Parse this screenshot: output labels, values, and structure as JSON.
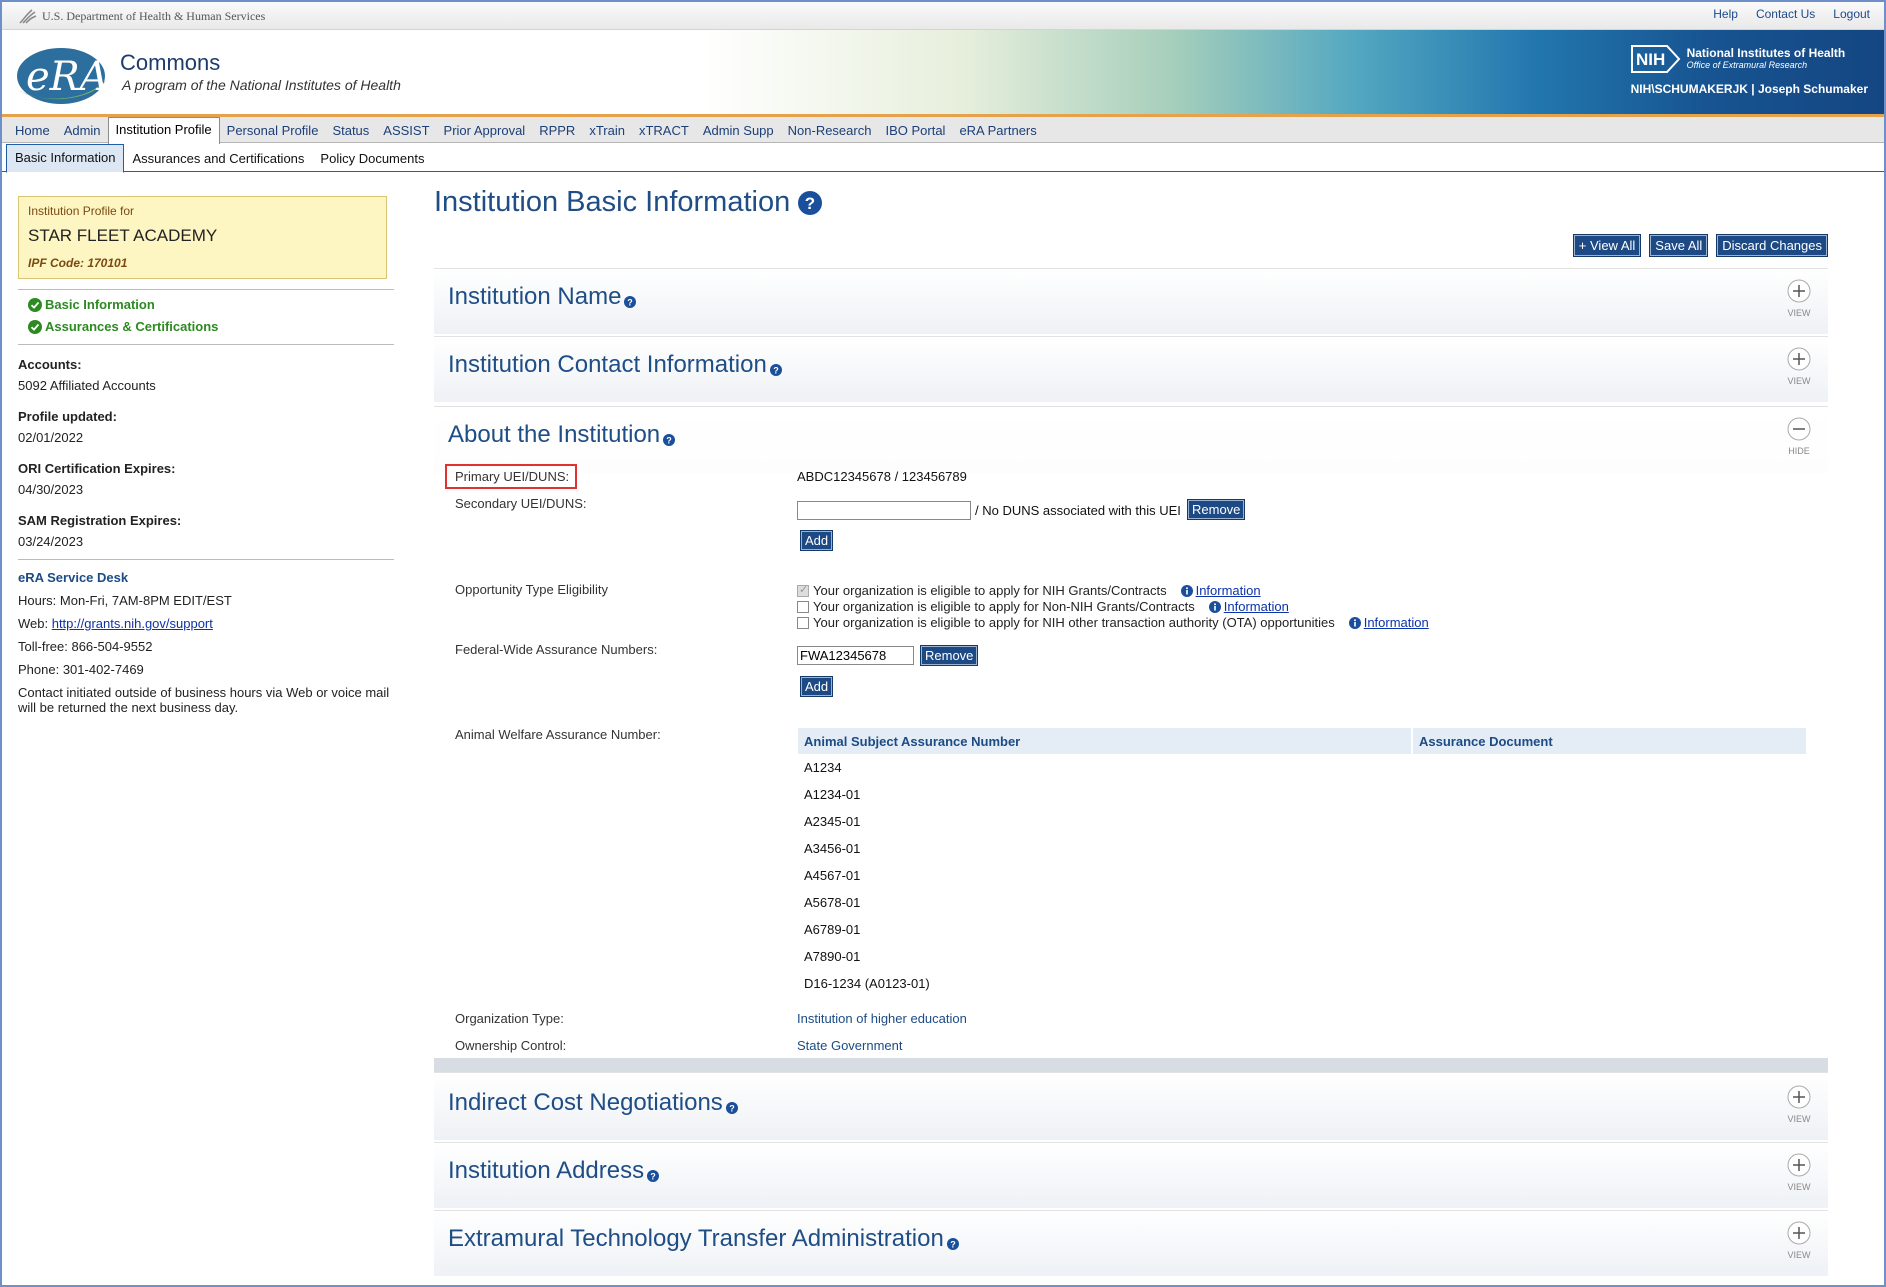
{
  "hhs": {
    "text": "U.S. Department of Health & Human Services"
  },
  "top_links": [
    "Help",
    "Contact Us",
    "Logout"
  ],
  "banner": {
    "title": "Commons",
    "subtitle": "A program of the National Institutes of Health",
    "nih_name": "National Institutes of Health",
    "nih_sub": "Office of Extramural Research",
    "nih_logo_text": "NIH",
    "user": "NIH\\SCHUMAKERJK | Joseph Schumaker"
  },
  "main_nav": [
    "Home",
    "Admin",
    "Institution Profile",
    "Personal Profile",
    "Status",
    "ASSIST",
    "Prior Approval",
    "RPPR",
    "xTrain",
    "xTRACT",
    "Admin Supp",
    "Non-Research",
    "IBO Portal",
    "eRA Partners"
  ],
  "main_nav_active": "Institution Profile",
  "sub_nav": [
    "Basic Information",
    "Assurances and Certifications",
    "Policy Documents"
  ],
  "sidebar": {
    "profile_label": "Institution Profile for",
    "institution_name": "STAR FLEET ACADEMY",
    "ipf_code": "IPF Code: 170101",
    "links": [
      "Basic Information",
      "Assurances & Certifications"
    ],
    "accounts_label": "Accounts:",
    "accounts_value": "5092 Affiliated Accounts",
    "updated_label": "Profile updated:",
    "updated_value": "02/01/2022",
    "ori_label": "ORI Certification Expires:",
    "ori_value": "04/30/2023",
    "sam_label": "SAM Registration Expires:",
    "sam_value": "03/24/2023",
    "desk_title": "eRA Service Desk",
    "hours": "Hours: Mon-Fri, 7AM-8PM EDIT/EST",
    "web_label": "Web: ",
    "web_link": "http://grants.nih.gov/support",
    "tollfree": "Toll-free: 866-504-9552",
    "phone": "Phone: 301-402-7469",
    "note": "Contact initiated outside of business hours via Web or voice mail will be returned the next business day."
  },
  "page": {
    "title": "Institution Basic Information",
    "buttons": {
      "view_all": "+ View All",
      "save_all": "Save All",
      "discard": "Discard Changes"
    }
  },
  "sections": {
    "name": "Institution Name",
    "contact": "Institution Contact Information",
    "about": "About the Institution",
    "indirect": "Indirect Cost Negotiations",
    "address": "Institution Address",
    "extramural": "Extramural Technology Transfer Administration",
    "view": "VIEW",
    "hide": "HIDE"
  },
  "about": {
    "primary_label": "Primary UEI/DUNS:",
    "primary_value": "ABDC12345678 / 123456789",
    "secondary_label": "Secondary UEI/DUNS:",
    "secondary_value": "",
    "secondary_note": "/ No DUNS associated with this UEI",
    "remove": "Remove",
    "add": "Add",
    "opportunity_label": "Opportunity Type Eligibility",
    "opportunities": [
      {
        "text": "Your organization is eligible to apply for NIH Grants/Contracts",
        "checked": true
      },
      {
        "text": "Your organization is eligible to apply for Non-NIH Grants/Contracts",
        "checked": false
      },
      {
        "text": "Your organization is eligible to apply for NIH other transaction authority (OTA) opportunities",
        "checked": false
      }
    ],
    "information": "Information",
    "fwa_label": "Federal-Wide Assurance Numbers:",
    "fwa_value": "FWA12345678",
    "animal_label": "Animal Welfare Assurance Number:",
    "table_headers": [
      "Animal Subject Assurance Number",
      "Assurance Document"
    ],
    "table_rows": [
      "A1234",
      "A1234-01",
      "A2345-01",
      "A3456-01",
      "A4567-01",
      "A5678-01",
      "A6789-01",
      "A7890-01",
      "D16-1234 (A0123-01)"
    ],
    "org_type_label": "Organization Type:",
    "org_type_value": "Institution of higher education",
    "ownership_label": "Ownership Control:",
    "ownership_value": "State Government"
  },
  "colors": {
    "brand_blue": "#1f4d86",
    "button_blue": "#1d4a84",
    "highlight_red": "#e0322e",
    "success_green": "#2d8a21"
  }
}
